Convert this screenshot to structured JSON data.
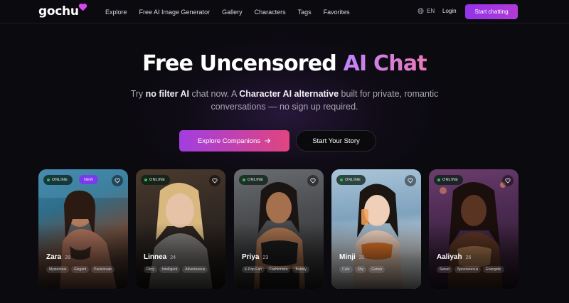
{
  "nav": {
    "logo": "gochu",
    "links": [
      "Explore",
      "Free AI Image Generator",
      "Gallery",
      "Characters",
      "Tags",
      "Favorites"
    ],
    "language": "EN",
    "login": "Login",
    "cta": "Start chatting"
  },
  "hero": {
    "title_part1": "Free Uncensored ",
    "title_accent": "AI Chat",
    "sub_1": "Try ",
    "sub_bold_1": "no filter AI",
    "sub_2": " chat now. A ",
    "sub_bold_2": "Character AI alternative",
    "sub_3": " built for private, romantic conversations — no sign up required.",
    "explore_label": "Explore Companions",
    "story_label": "Start Your Story"
  },
  "cards": [
    {
      "name": "Zara",
      "age": "28",
      "status": "ONLINE",
      "badge": "NEW",
      "tags": [
        "Mysterious",
        "Elegant",
        "Passionate"
      ]
    },
    {
      "name": "Linnea",
      "age": "24",
      "status": "ONLINE",
      "badge": "",
      "tags": [
        "Flirty",
        "Intelligent",
        "Adventurous"
      ]
    },
    {
      "name": "Priya",
      "age": "23",
      "status": "ONLINE",
      "badge": "",
      "tags": [
        "K-Pop Fan",
        "Fashionista",
        "Bubbly"
      ]
    },
    {
      "name": "Minji",
      "age": "20",
      "status": "ONLINE",
      "badge": "",
      "tags": [
        "Cute",
        "Shy",
        "Gamer"
      ]
    },
    {
      "name": "Aaliyah",
      "age": "26",
      "status": "ONLINE",
      "badge": "",
      "tags": [
        "Sweet",
        "Spontaneous",
        "Energetic"
      ]
    }
  ],
  "colors": {
    "background": "#0b0a0f",
    "accent_purple": "#9333ea",
    "accent_pink": "#e0457f",
    "online_green": "#22c55e"
  }
}
